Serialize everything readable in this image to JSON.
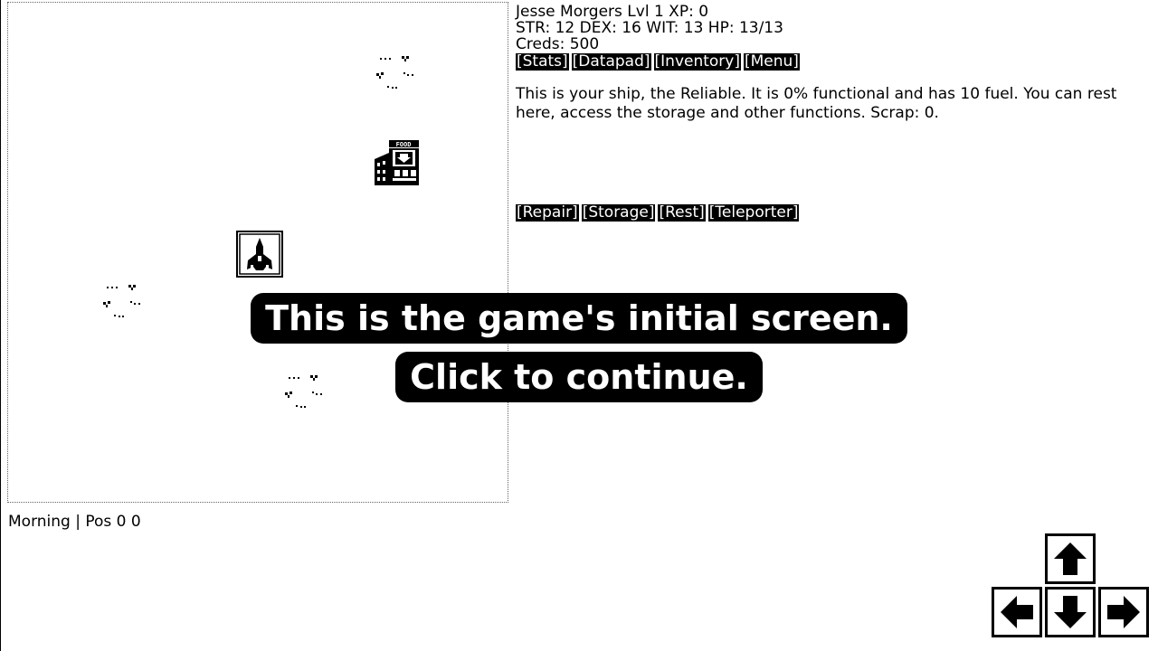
{
  "player": {
    "line1": "Jesse Morgers Lvl 1 XP: 0",
    "line2": "STR: 12 DEX: 16 WIT: 13 HP: 13/13",
    "line3": "Creds: 500"
  },
  "menu": {
    "stats": "[Stats]",
    "datapad": "[Datapad]",
    "inventory": "[Inventory]",
    "menu": "[Menu]"
  },
  "location": {
    "description": "This is your ship, the Reliable. It is 0% functional and has 10 fuel. You can rest here, access the storage and other functions. Scrap: 0."
  },
  "actions": {
    "repair": "[Repair]",
    "storage": "[Storage]",
    "rest": "[Rest]",
    "teleporter": "[Teleporter]"
  },
  "status_bar": "Morning | Pos 0 0",
  "tutorial": {
    "line1": "This is the game's initial screen.",
    "line2": "Click to continue."
  },
  "map": {
    "building_sign": "FOOD",
    "icons": [
      "debris-icon",
      "food-building-icon",
      "player-ship-icon",
      "debris-icon",
      "debris-icon"
    ]
  },
  "controls": {
    "icons": [
      "arrow-up-icon",
      "arrow-left-icon",
      "arrow-down-icon",
      "arrow-right-icon"
    ]
  }
}
